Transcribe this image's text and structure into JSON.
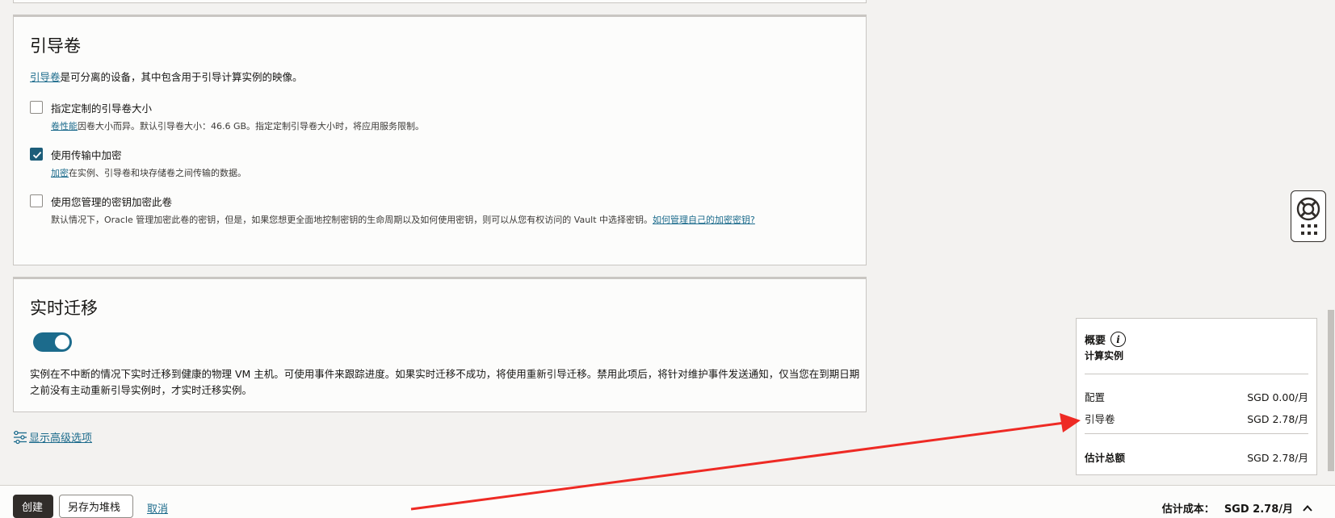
{
  "boot_volume": {
    "title": "引导卷",
    "lead_link": "引导卷",
    "lead_text": "是可分离的设备，其中包含用于引导计算实例的映像。",
    "options": [
      {
        "label": "指定定制的引导卷大小",
        "checked": false,
        "help_link": "卷性能",
        "help_text": "因卷大小而异。默认引导卷大小：46.6 GB。指定定制引导卷大小时，将应用服务限制。"
      },
      {
        "label": "使用传输中加密",
        "checked": true,
        "help_link": "加密",
        "help_text": "在实例、引导卷和块存储卷之间传输的数据。"
      },
      {
        "label": "使用您管理的密钥加密此卷",
        "checked": false,
        "help_text": "默认情况下，Oracle 管理加密此卷的密钥，但是，如果您想更全面地控制密钥的生命周期以及如何使用密钥，则可以从您有权访问的 Vault 中选择密钥。",
        "help_link": "如何管理自己的加密密钥?"
      }
    ]
  },
  "live_migration": {
    "title": "实时迁移",
    "toggle_on": true,
    "description": "实例在不中断的情况下实时迁移到健康的物理 VM 主机。可使用事件来跟踪进度。如果实时迁移不成功，将使用重新引导迁移。禁用此项后，将针对维护事件发送通知，仅当您在到期日期之前没有主动重新引导实例时，才实时迁移实例。"
  },
  "advanced": {
    "label": "显示高级选项"
  },
  "footer": {
    "create_label": "创建",
    "save_stack_label": "另存为堆栈",
    "cancel_label": "取消",
    "cost_label": "估计成本：",
    "cost_value": "SGD 2.78/月"
  },
  "summary": {
    "title": "概要",
    "subtitle": "计算实例",
    "rows": [
      {
        "label": "配置",
        "value": "SGD 0.00/月"
      },
      {
        "label": "引导卷",
        "value": "SGD 2.78/月"
      }
    ],
    "total_label": "估计总额",
    "total_value": "SGD 2.78/月"
  },
  "colors": {
    "accent": "#1c6b8c",
    "checkbox_checked": "#1c5d79",
    "primary_button": "#312d2a",
    "annotation_arrow": "#ee2a24"
  }
}
